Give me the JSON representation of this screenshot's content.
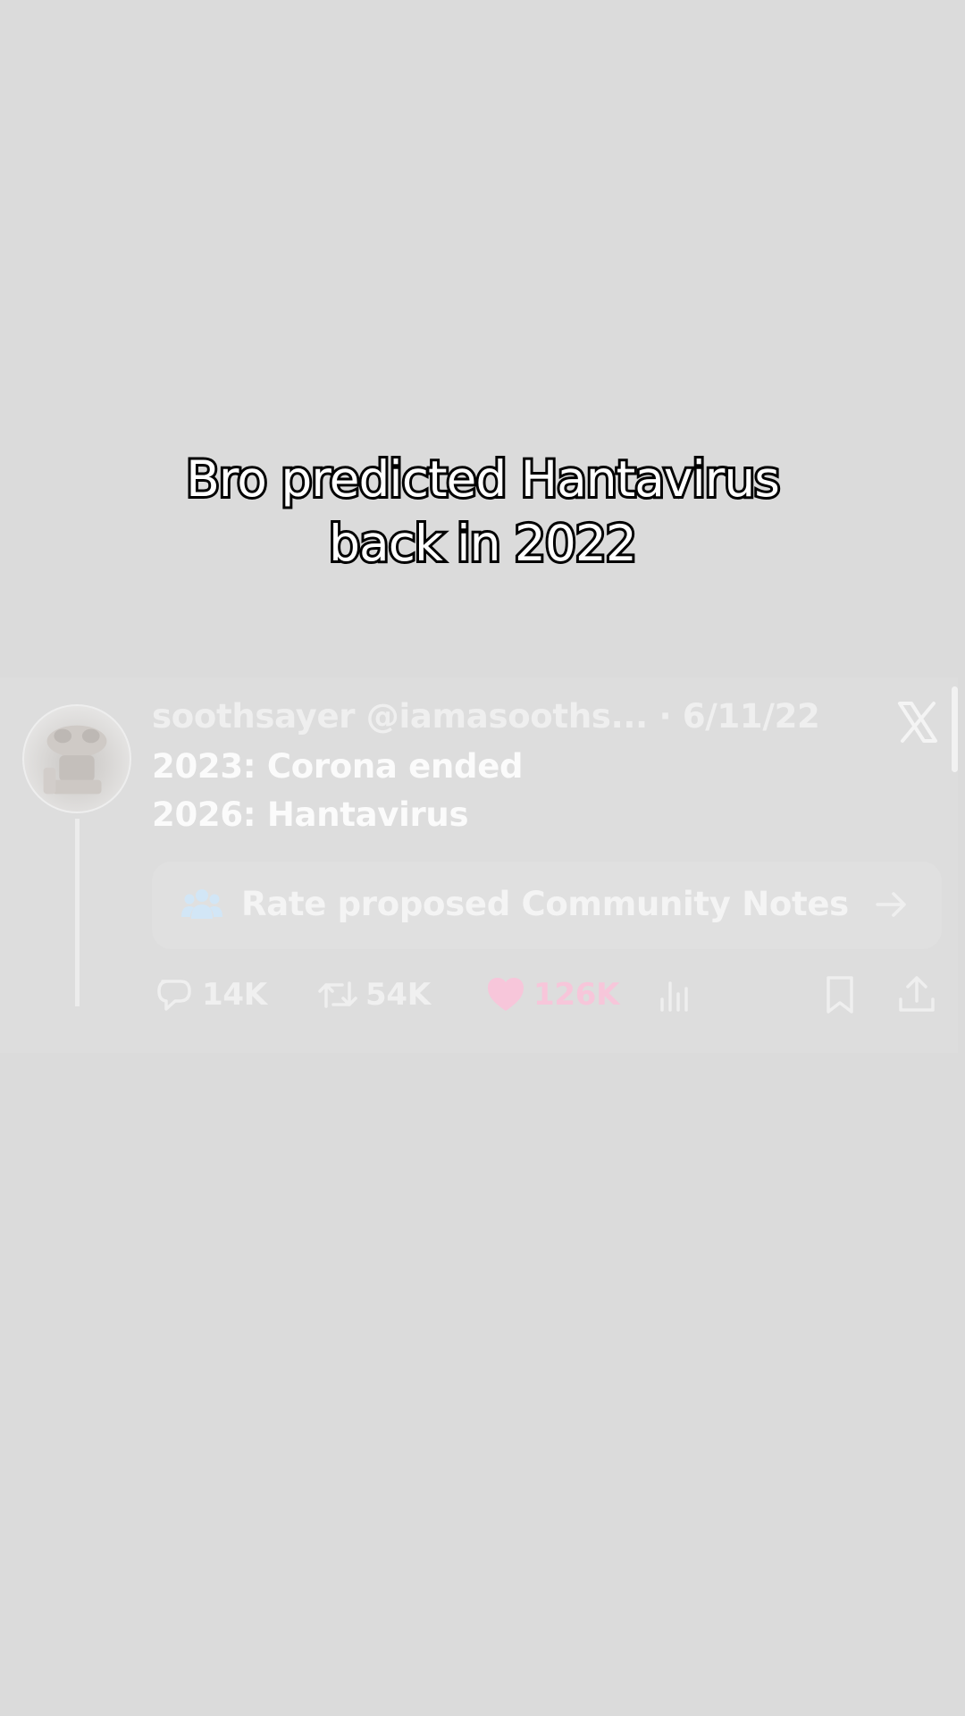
{
  "caption": {
    "line1": "Bro predicted Hantavirus",
    "line2": "back in 2022"
  },
  "tweet": {
    "display_name": "soothsayer",
    "handle": "@iamasooths...",
    "separator": "·",
    "date": "6/11/22",
    "text_lines": [
      "2023: Corona ended",
      "2026: Hantavirus"
    ],
    "community_note_label": "Rate proposed Community Notes",
    "actions": {
      "replies": "14K",
      "retweets": "54K",
      "likes": "126K"
    }
  },
  "icons": {
    "avatar": "avatar-image",
    "platform": "x-logo-icon",
    "community": "people-icon",
    "arrow": "arrow-right-icon",
    "reply": "reply-icon",
    "retweet": "retweet-icon",
    "like": "heart-icon",
    "views": "views-icon",
    "bookmark": "bookmark-icon",
    "share": "share-icon"
  },
  "colors": {
    "background": "#dbdbdb",
    "caption_text": "#ffffff",
    "caption_outline": "#000000",
    "like_accent": "#f7c6da"
  }
}
